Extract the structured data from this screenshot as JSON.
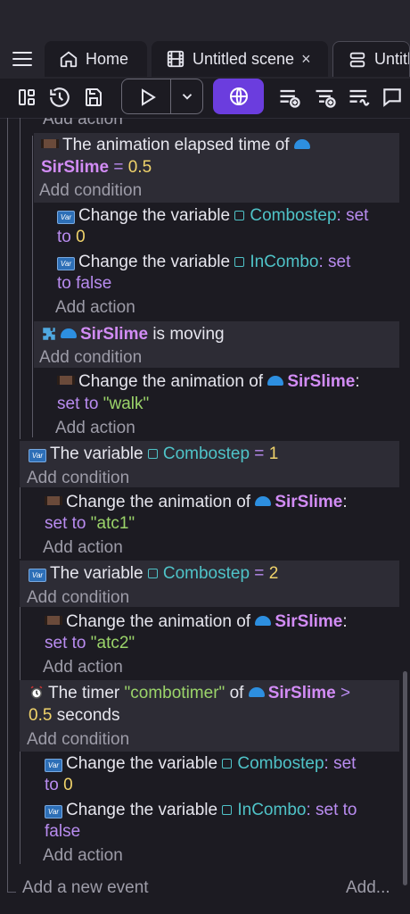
{
  "tabs": [
    {
      "label": "Home",
      "icon": "home-icon"
    },
    {
      "label": "Untitled scene",
      "icon": "film-icon",
      "close": "×"
    },
    {
      "label": "Untitle",
      "icon": "database-icon"
    }
  ],
  "toolbar": {
    "accent": "#6b3dde"
  },
  "events": {
    "top_cut_action": "Add action",
    "e1": {
      "cond_text": "The animation elapsed time of",
      "obj": "SirSlime",
      "op": "=",
      "value": "0.5",
      "add_condition": "Add condition",
      "a1_text": "Change the variable",
      "a1_var": "Combostep",
      "a1_set": ": set",
      "a1_to": "to",
      "a1_val": "0",
      "a2_text": "Change the variable",
      "a2_var": "InCombo",
      "a2_set": ": set",
      "a2_to": "to false",
      "add_action": "Add action"
    },
    "e2": {
      "obj": "SirSlime",
      "cond_text": "is moving",
      "add_condition": "Add condition",
      "a1_text": "Change the animation of",
      "a1_obj": "SirSlime",
      "a1_colon": ":",
      "a1_set": "set to",
      "a1_val": "\"walk\"",
      "add_action": "Add action"
    },
    "e3": {
      "cond_text": "The variable",
      "var": "Combostep",
      "op": "=",
      "value": "1",
      "add_condition": "Add condition",
      "a1_text": "Change the animation of",
      "a1_obj": "SirSlime",
      "a1_colon": ":",
      "a1_set": "set to",
      "a1_val": "\"atc1\"",
      "add_action": "Add action"
    },
    "e4": {
      "cond_text": "The variable",
      "var": "Combostep",
      "op": "=",
      "value": "2",
      "add_condition": "Add condition",
      "a1_text": "Change the animation of",
      "a1_obj": "SirSlime",
      "a1_colon": ":",
      "a1_set": "set to",
      "a1_val": "\"atc2\"",
      "add_action": "Add action"
    },
    "e5": {
      "cond_text": "The timer",
      "timer": "\"combotimer\"",
      "of": "of",
      "obj": "SirSlime",
      "op": ">",
      "value": "0.5",
      "unit": "seconds",
      "add_condition": "Add condition",
      "a1_text": "Change the variable",
      "a1_var": "Combostep",
      "a1_set": ": set",
      "a1_to": "to",
      "a1_val": "0",
      "a2_text": "Change the variable",
      "a2_var": "InCombo",
      "a2_set": ": set to",
      "a2_to": "false",
      "add_action": "Add action"
    },
    "add_event": "Add a new event",
    "add_more": "Add..."
  }
}
